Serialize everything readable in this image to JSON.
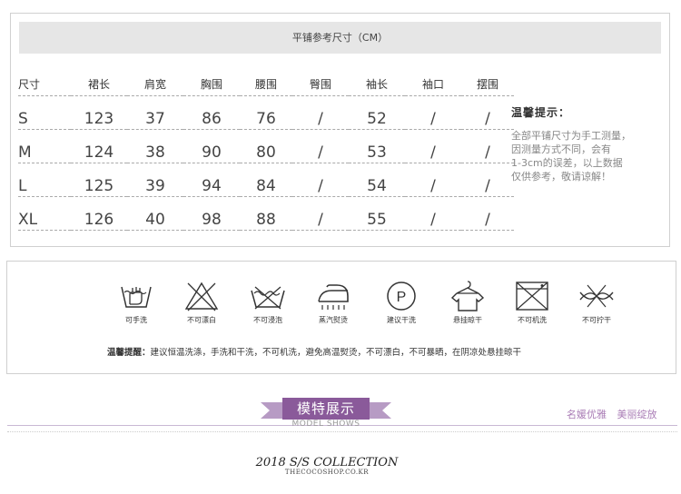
{
  "size_chart": {
    "title": "平铺参考尺寸（CM）",
    "headers": [
      "尺寸",
      "裙长",
      "肩宽",
      "胸围",
      "腰围",
      "臀围",
      "袖长",
      "袖口",
      "摆围"
    ],
    "rows": [
      [
        "S",
        "123",
        "37",
        "86",
        "76",
        "/",
        "52",
        "/",
        "/"
      ],
      [
        "M",
        "124",
        "38",
        "90",
        "80",
        "/",
        "53",
        "/",
        "/"
      ],
      [
        "L",
        "125",
        "39",
        "94",
        "84",
        "/",
        "54",
        "/",
        "/"
      ],
      [
        "XL",
        "126",
        "40",
        "98",
        "88",
        "/",
        "55",
        "/",
        "/"
      ]
    ]
  },
  "tips": {
    "title": "温馨提示：",
    "lines": [
      "全部平铺尺寸为手工测量，",
      "因测量方式不同，会有",
      "1-3cm的误差，以上数据",
      "仅供参考，敬请谅解！"
    ]
  },
  "care": {
    "icons": [
      {
        "icon": "hand-wash-icon",
        "label": "可手洗"
      },
      {
        "icon": "no-bleach-icon",
        "label": "不可漂白"
      },
      {
        "icon": "no-soak-icon",
        "label": "不可浸泡"
      },
      {
        "icon": "steam-iron-icon",
        "label": "蒸汽熨烫"
      },
      {
        "icon": "dry-clean-icon",
        "label": "建议干洗"
      },
      {
        "icon": "hang-dry-icon",
        "label": "悬挂晾干"
      },
      {
        "icon": "no-machine-wash-icon",
        "label": "不可机洗"
      },
      {
        "icon": "no-wring-icon",
        "label": "不可拧干"
      }
    ],
    "note_label": "温馨提醒：",
    "note_text": "建议恒温洗涤，手洗和干洗，不可机洗，避免高温熨烫，不可漂白，不可暴晒，在阴凉处悬挂晾干"
  },
  "banner": {
    "title": "模特展示",
    "subtitle": "MODEL SHOWS",
    "right_text": "名媛优雅 美丽绽放",
    "accent": "#8a5a9a"
  },
  "collection": {
    "title": "2018 S/S COLLECTION",
    "site": "THECOCOSHOP.CO.KR"
  }
}
